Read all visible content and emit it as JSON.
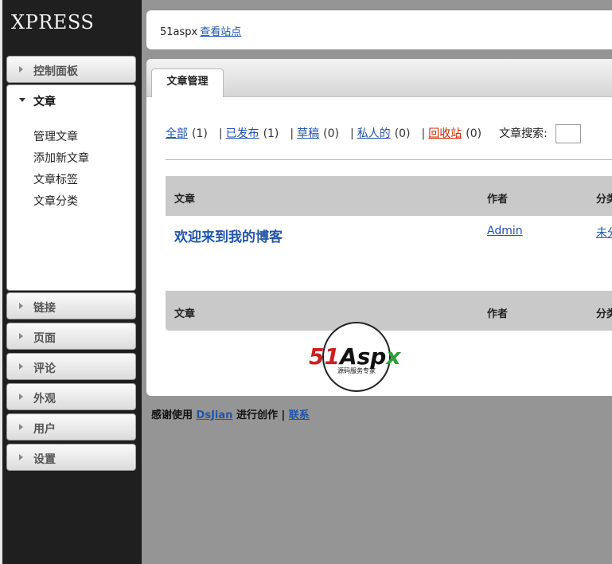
{
  "app": {
    "logo": "XPRESS"
  },
  "sidebar": {
    "items": [
      {
        "label": "控制面板"
      },
      {
        "label": "文章",
        "expanded": true,
        "children": [
          "管理文章",
          "添加新文章",
          "文章标签",
          "文章分类"
        ]
      },
      {
        "label": "链接"
      },
      {
        "label": "页面"
      },
      {
        "label": "评论"
      },
      {
        "label": "外观"
      },
      {
        "label": "用户"
      },
      {
        "label": "设置"
      }
    ]
  },
  "header": {
    "site_name": "51aspx",
    "view_site": "查看站点"
  },
  "tabs": {
    "active": "文章管理"
  },
  "filters": {
    "all": "全部",
    "all_count": "(1)",
    "published": "已发布",
    "published_count": "(1)",
    "draft": "草稿",
    "draft_count": "(0)",
    "private": "私人的",
    "private_count": "(0)",
    "trash": "回收站",
    "trash_count": "(0)",
    "separator": "|",
    "search_label": "文章搜索:"
  },
  "table": {
    "columns": [
      "文章",
      "作者",
      "分类"
    ],
    "rows": [
      {
        "title": "欢迎来到我的博客",
        "author": "Admin",
        "category": "未分类"
      }
    ]
  },
  "watermark": {
    "brand": "51Aspx",
    "tagline": "源码服务专家"
  },
  "footer": {
    "prefix": "感谢使用",
    "link": "DsJian",
    "middle": "进行创作",
    "sep": "|",
    "contact": "联系"
  },
  "colors": {
    "link": "#2255aa",
    "trash": "#cc2a00",
    "sidebar_bg": "#1f1f1f",
    "page_bg": "#959595"
  }
}
